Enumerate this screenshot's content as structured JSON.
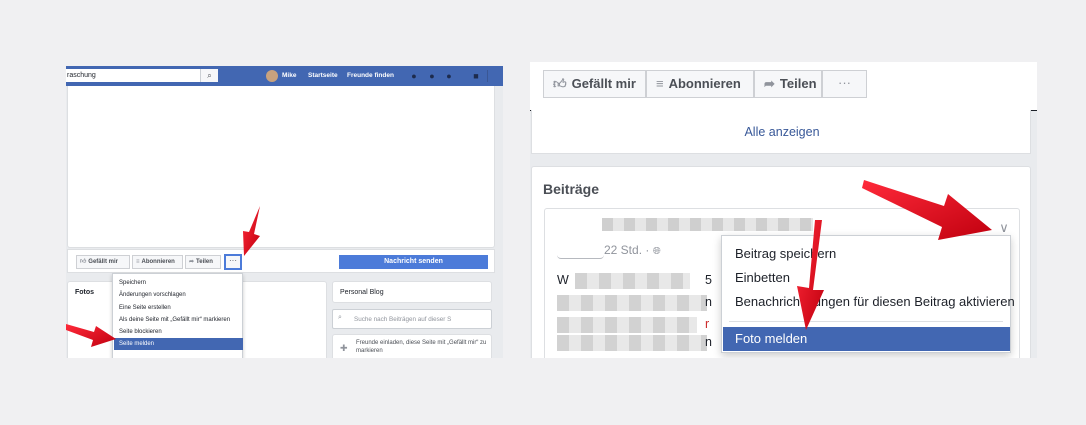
{
  "left_panel": {
    "topbar": {
      "search_value": "raschung",
      "search_icon": "magnifier-icon",
      "user_name": "Mike",
      "home_link": "Startseite",
      "find_friends_link": "Freunde finden"
    },
    "actions": {
      "like": "Gefällt mir",
      "subscribe": "Abonnieren",
      "share": "Teilen",
      "more": "···",
      "send_message": "Nachricht senden"
    },
    "dropdown": {
      "items": [
        "Speichern",
        "Änderungen vorschlagen",
        "Eine Seite erstellen",
        "Als deine Seite mit „Gefällt mir“ markieren",
        "Seite blockieren",
        "Seite melden"
      ],
      "highlighted": "Seite melden"
    },
    "fotos_title": "Fotos",
    "blog_title": "Personal Blog",
    "blog_search_placeholder": "Suche nach Beiträgen auf dieser S",
    "invite_text": "Freunde einladen, diese Seite mit „Gefällt mir“ zu markieren"
  },
  "right_panel": {
    "actions": {
      "like": "Gefällt mir",
      "subscribe": "Abonnieren",
      "share": "Teilen",
      "more": "···"
    },
    "see_all": "Alle anzeigen",
    "posts_title": "Beiträge",
    "post": {
      "time": "22 Std. ·",
      "snippet_start": "W",
      "snippet_right": "5",
      "trail_1": "n",
      "trail_2": "r",
      "trail_3": "n"
    },
    "dropdown": {
      "items": [
        "Beitrag speichern",
        "Einbetten",
        "Benachrichtigungen für diesen Beitrag aktivieren",
        "Foto melden"
      ],
      "highlighted": "Foto melden"
    }
  },
  "colors": {
    "facebook_blue": "#4267b2",
    "button_blue": "#4c7bd9",
    "link_blue": "#385898",
    "annotation_red": "#e3071d"
  }
}
